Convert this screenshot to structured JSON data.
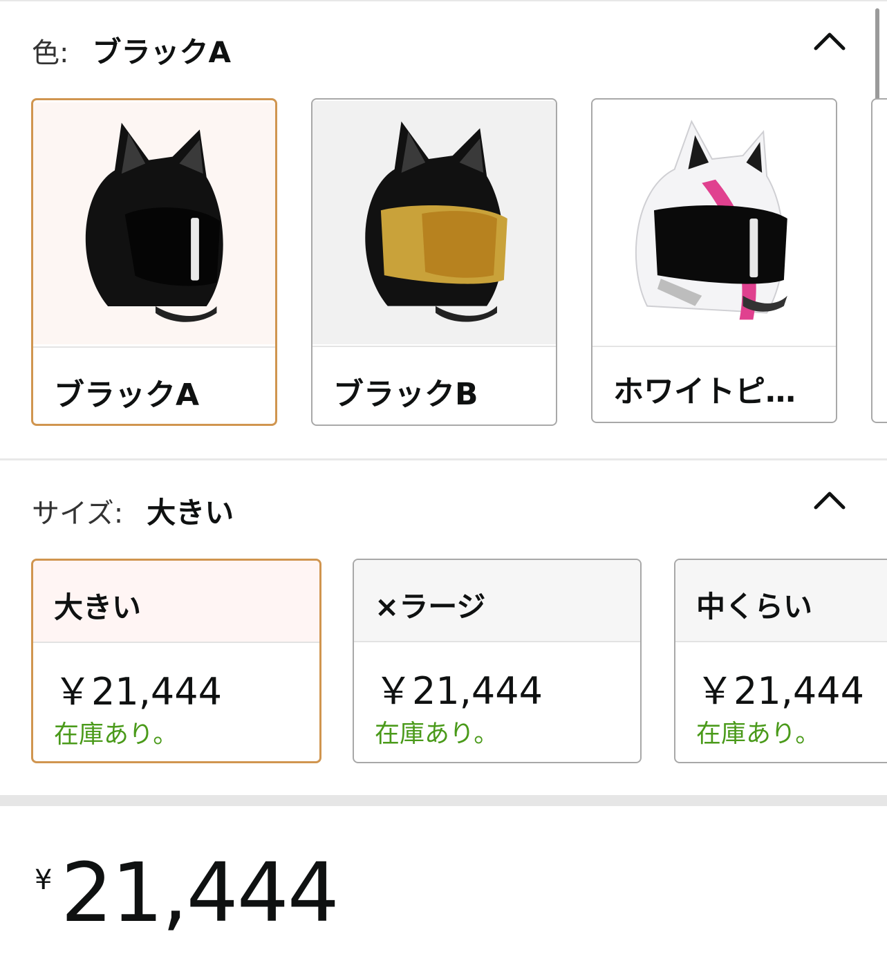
{
  "color_section": {
    "key_label": "色:",
    "selected_value": "ブラックA",
    "options": [
      {
        "label": "ブラックA",
        "selected": true
      },
      {
        "label": "ブラックB",
        "selected": false
      },
      {
        "label": "ホワイトピ…",
        "selected": false
      }
    ]
  },
  "size_section": {
    "key_label": "サイズ:",
    "selected_value": "大きい",
    "options": [
      {
        "name": "大きい",
        "price": "￥21,444",
        "stock": "在庫あり。",
        "selected": true
      },
      {
        "name": "×ラージ",
        "price": "￥21,444",
        "stock": "在庫あり。",
        "selected": false
      },
      {
        "name": "中くらい",
        "price": "￥21,444",
        "stock": "在庫あり。",
        "selected": false
      }
    ]
  },
  "price_block": {
    "currency_symbol": "¥",
    "amount": "21,444"
  },
  "icons": {
    "collapse": "chevron-up-icon"
  },
  "colors": {
    "selected_border": "#d0954f",
    "in_stock_text": "#4a9a1a",
    "card_border": "#a8a8a8"
  }
}
